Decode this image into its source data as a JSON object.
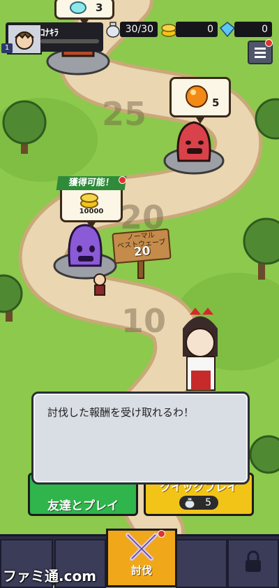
{
  "player": {
    "level": "1",
    "name": "ｺﾅｷﾗ"
  },
  "resources": [
    {
      "name": "stamina",
      "icon": "stamina-bottle-icon",
      "value": "30/30"
    },
    {
      "name": "coins",
      "icon": "coin-stack-icon",
      "value": "0"
    },
    {
      "name": "gems",
      "icon": "gem-icon",
      "value": "0"
    }
  ],
  "map": {
    "wave_markers": [
      "25",
      "20",
      "10"
    ],
    "top_reward_count": "3",
    "stage25_reward_count": "5",
    "claimable_label": "獲得可能！",
    "claimable_reward": "10000",
    "signpost": {
      "line1": "ノーマル",
      "line2": "ベストウェーブ",
      "wave": "20"
    }
  },
  "dialog": {
    "text": "討伐した報酬を受け取れるわ！"
  },
  "buttons": {
    "friends_label": "友達とプレイ",
    "quick_label": "クイックプレイ",
    "quick_cost": "5"
  },
  "nav": {
    "active_label": "討伐"
  },
  "watermark": "ファミ通.com",
  "colors": {
    "friends": "#2fb54b",
    "quick": "#f2c418",
    "active_tab": "#f0a81a",
    "notification": "#e3322c"
  }
}
